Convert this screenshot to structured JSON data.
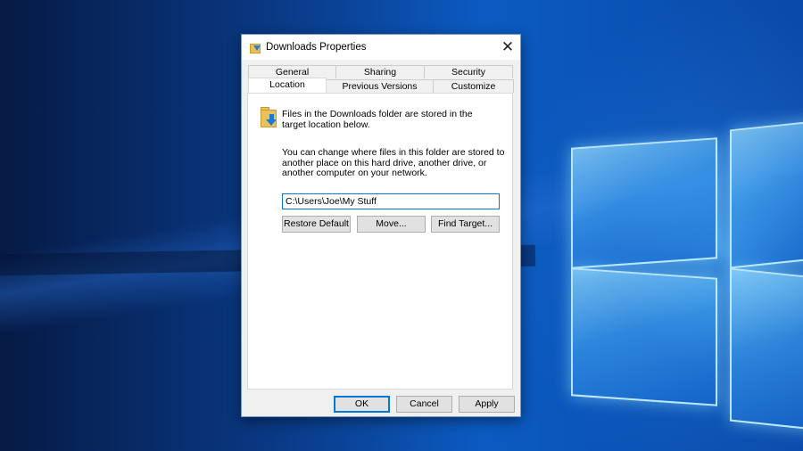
{
  "window": {
    "title": "Downloads Properties",
    "close_glyph": "✕"
  },
  "tabs": {
    "back_row": [
      {
        "label": "General"
      },
      {
        "label": "Sharing"
      },
      {
        "label": "Security"
      }
    ],
    "front_row": [
      {
        "label": "Location",
        "active": true
      },
      {
        "label": "Previous Versions"
      },
      {
        "label": "Customize"
      }
    ]
  },
  "location": {
    "description": "Files in the Downloads folder are stored in the target location below.",
    "help_text": "You can change where files in this folder are stored to another place on this hard drive, another drive, or another computer on your network.",
    "path_value": "C:\\Users\\Joe\\My Stuff",
    "buttons": {
      "restore_default": "Restore Default",
      "move": "Move...",
      "find_target": "Find Target..."
    }
  },
  "footer": {
    "ok": "OK",
    "cancel": "Cancel",
    "apply": "Apply"
  },
  "icons": {
    "title_icon": "downloads-folder-icon",
    "panel_icon": "downloads-folder-icon",
    "close": "close-icon"
  },
  "colors": {
    "accent": "#0078d7",
    "dialog_bg": "#f0f0f0",
    "panel_bg": "#ffffff",
    "folder": "#e9c25b",
    "arrow": "#1d79d1"
  }
}
